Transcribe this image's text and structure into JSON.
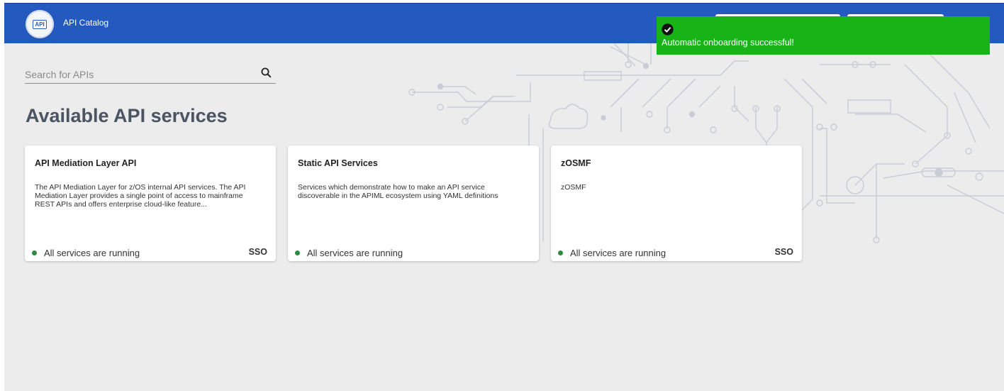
{
  "header": {
    "logo_text": "API",
    "title": "API Catalog"
  },
  "search": {
    "placeholder": "Search for APIs",
    "value": ""
  },
  "page": {
    "title": "Available API services"
  },
  "cards": [
    {
      "title": "API Mediation Layer API",
      "description": "The API Mediation Layer for z/OS internal API services. The API Mediation Layer provides a single point of access to mainframe REST APIs and offers enterprise cloud-like feature...",
      "status": "All services are running",
      "badge": "SSO"
    },
    {
      "title": "Static API Services",
      "description": "Services which demonstrate how to make an API service discoverable in the APIML ecosystem using YAML definitions",
      "status": "All services are running",
      "badge": ""
    },
    {
      "title": "zOSMF",
      "description": "zOSMF",
      "status": "All services are running",
      "badge": "SSO"
    }
  ],
  "toast": {
    "message": "Automatic onboarding successful!",
    "icon": "check-circle-icon"
  },
  "colors": {
    "header": "#2459c0",
    "background": "#ececec",
    "status_running": "#2e8b3e",
    "toast_success": "#17b317"
  }
}
